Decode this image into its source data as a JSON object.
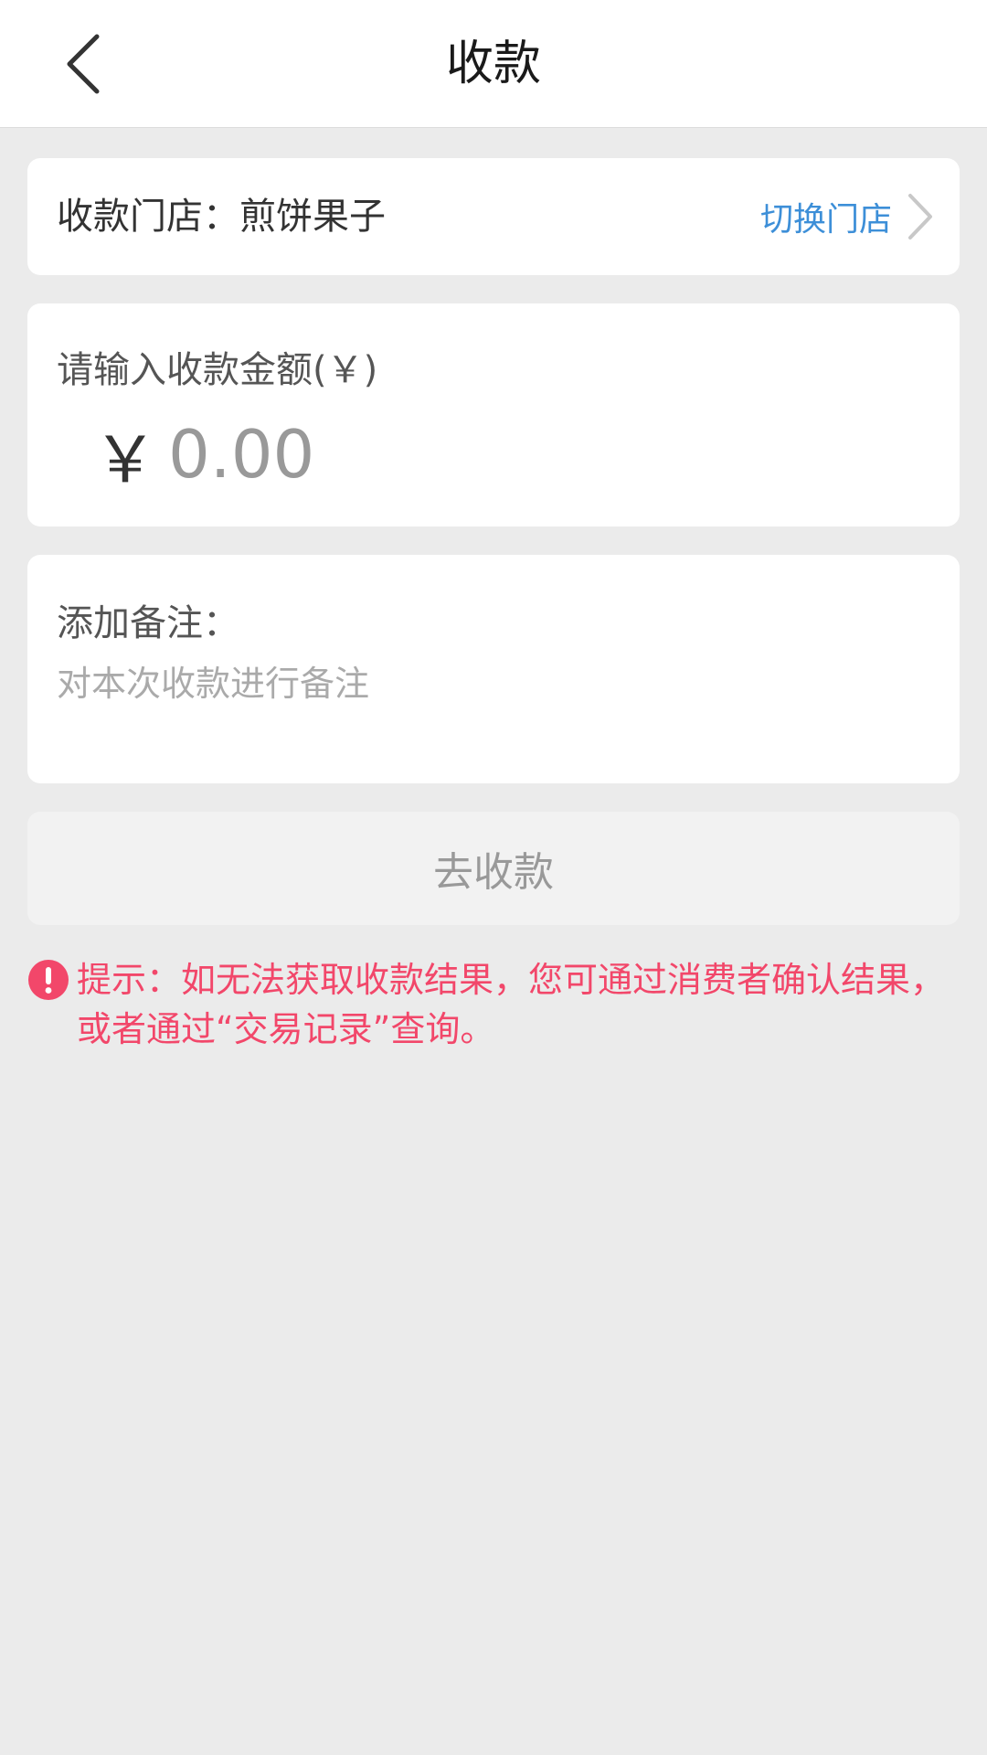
{
  "header": {
    "title": "收款",
    "back_icon": "chevron-left-icon"
  },
  "store": {
    "label": "收款门店：煎饼果子",
    "switch_label": "切换门店",
    "switch_icon": "chevron-right-icon"
  },
  "amount": {
    "label": "请输入收款金额(￥)",
    "currency_symbol": "￥",
    "placeholder": "0.00"
  },
  "note": {
    "label": "添加备注：",
    "placeholder": "对本次收款进行备注"
  },
  "submit": {
    "label": "去收款"
  },
  "tip": {
    "icon": "exclamation-circle-icon",
    "text": "提示：如无法获取收款结果，您可通过消费者确认结果，或者通过“交易记录”查询。"
  },
  "colors": {
    "accent_blue": "#3d8fd8",
    "tip_red": "#f2476a",
    "background": "#ebebeb"
  }
}
